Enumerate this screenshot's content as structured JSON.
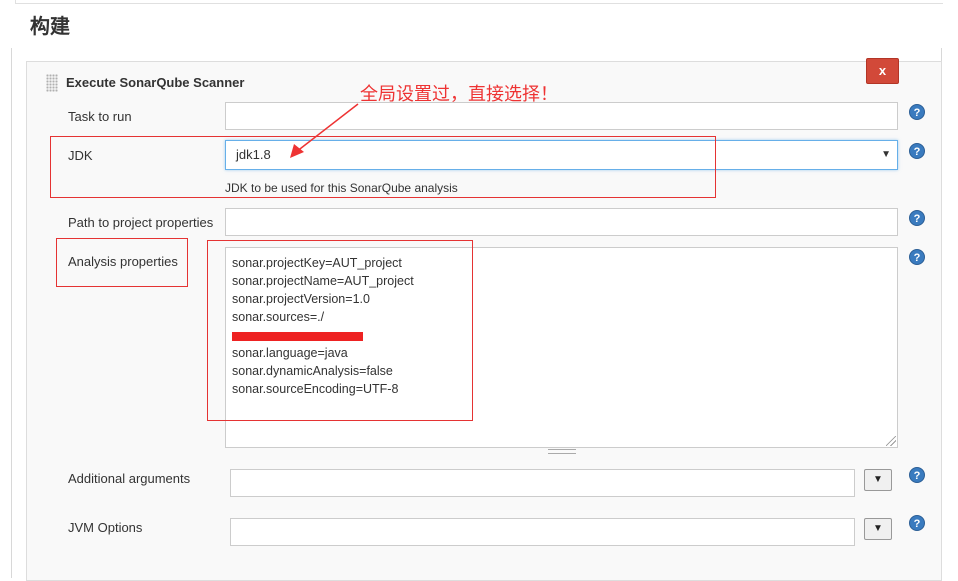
{
  "section": {
    "title": "构建"
  },
  "step": {
    "title": "Execute SonarQube Scanner",
    "delete_label": "x"
  },
  "fields": {
    "task_to_run": {
      "label": "Task to run",
      "value": ""
    },
    "jdk": {
      "label": "JDK",
      "selected": "jdk1.8",
      "hint": "JDK to be used for this SonarQube analysis"
    },
    "path_to_properties": {
      "label": "Path to project properties",
      "value": ""
    },
    "analysis_properties": {
      "label": "Analysis properties",
      "lines": [
        "sonar.projectKey=AUT_project",
        "sonar.projectName=AUT_project",
        "sonar.projectVersion=1.0",
        "sonar.sources=./",
        "",
        "sonar.language=java",
        "sonar.dynamicAnalysis=false",
        "sonar.sourceEncoding=UTF-8"
      ]
    },
    "additional_arguments": {
      "label": "Additional arguments",
      "value": ""
    },
    "jvm_options": {
      "label": "JVM Options",
      "value": ""
    }
  },
  "help_icon": "question-circle-icon",
  "help_symbol": "?",
  "select_arrow": "▼",
  "expand_symbol": "▼",
  "annotation": {
    "text": "全局设置过，直接选择！",
    "color": "#ee3333"
  },
  "colors": {
    "delete": "#d24939",
    "help": "#3a7bbf",
    "highlight": "#e53333",
    "focus": "#66afe9"
  }
}
